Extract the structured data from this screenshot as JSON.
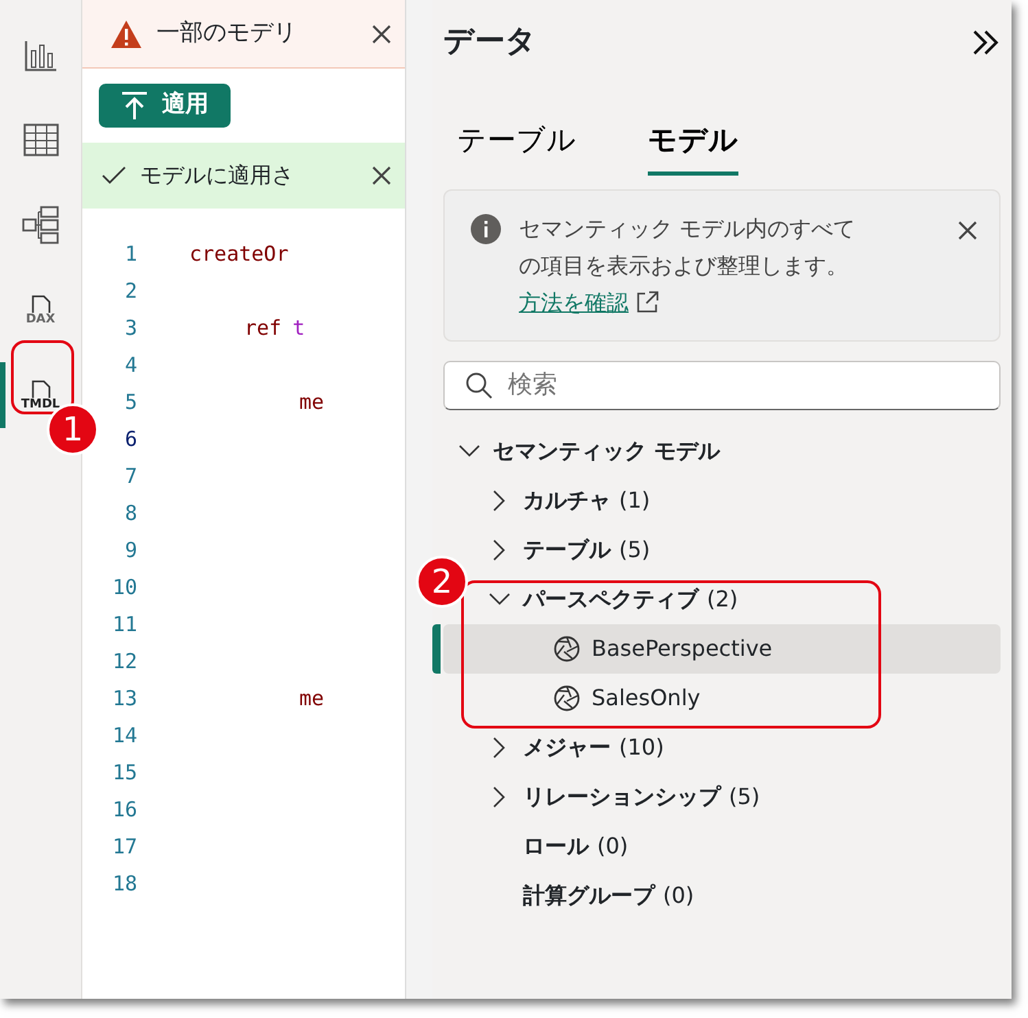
{
  "rail": [
    {
      "kind": "report",
      "selected": false
    },
    {
      "kind": "table",
      "selected": false
    },
    {
      "kind": "model",
      "selected": false
    },
    {
      "kind": "dax",
      "icon_text": "DAX",
      "selected": false
    },
    {
      "kind": "tmdl",
      "icon_text": "TMDL",
      "selected": true
    }
  ],
  "warning_bar": {
    "text": "一部のモデリ"
  },
  "apply_button": "適用",
  "success_bar": {
    "text": "モデルに適用さ"
  },
  "editor": {
    "lines": [
      {
        "number": "1",
        "current": false,
        "kind": "top",
        "tokens": [
          {
            "kind": "keyword",
            "text": "createOr"
          }
        ]
      },
      {
        "number": "2",
        "current": false
      },
      {
        "number": "3",
        "current": false,
        "kind": "nested",
        "tokens": [
          {
            "kind": "keyword",
            "text": "ref"
          },
          {
            "kind": "name",
            "text": "t"
          }
        ]
      },
      {
        "number": "4",
        "current": false
      },
      {
        "number": "5",
        "current": false,
        "kind": "deep",
        "tokens": [
          {
            "kind": "keyword",
            "text": "me"
          }
        ]
      },
      {
        "number": "6",
        "current": true
      },
      {
        "number": "7",
        "current": false
      },
      {
        "number": "8",
        "current": false
      },
      {
        "number": "9",
        "current": false
      },
      {
        "number": "10",
        "current": false
      },
      {
        "number": "11",
        "current": false
      },
      {
        "number": "12",
        "current": false
      },
      {
        "number": "13",
        "current": false,
        "kind": "deep",
        "tokens": [
          {
            "kind": "keyword",
            "text": "me"
          }
        ]
      },
      {
        "number": "14",
        "current": false
      },
      {
        "number": "15",
        "current": false
      },
      {
        "number": "16",
        "current": false
      },
      {
        "number": "17",
        "current": false
      },
      {
        "number": "18",
        "current": false
      }
    ]
  },
  "data_pane": {
    "title": "データ",
    "tabs": [
      {
        "label": "テーブル",
        "selected": false
      },
      {
        "label": "モデル",
        "selected": true
      }
    ],
    "info": {
      "text": "セマンティック モデル内のすべての項目を表示および整理します。",
      "link": "方法を確認"
    },
    "search": {
      "placeholder": "検索"
    },
    "tree": [
      {
        "label": "セマンティック モデル",
        "expanded": true,
        "children": [
          {
            "label": "カルチャ",
            "count": "(1)",
            "expanded": false
          },
          {
            "label": "テーブル",
            "count": "(5)",
            "expanded": false
          },
          {
            "label": "パースペクティブ",
            "count": "(2)",
            "expanded": true,
            "children": [
              {
                "label": "BasePerspective",
                "kind": "perspective",
                "selected": true
              },
              {
                "label": "SalesOnly",
                "kind": "perspective",
                "selected": false
              }
            ]
          },
          {
            "label": "メジャー",
            "count": "(10)",
            "expanded": false
          },
          {
            "label": "リレーションシップ",
            "count": "(5)",
            "expanded": false
          },
          {
            "label": "ロール",
            "count": "(0)"
          },
          {
            "label": "計算グループ",
            "count": "(0)"
          }
        ]
      }
    ]
  },
  "callouts": [
    {
      "label": "1"
    },
    {
      "label": "2"
    }
  ]
}
